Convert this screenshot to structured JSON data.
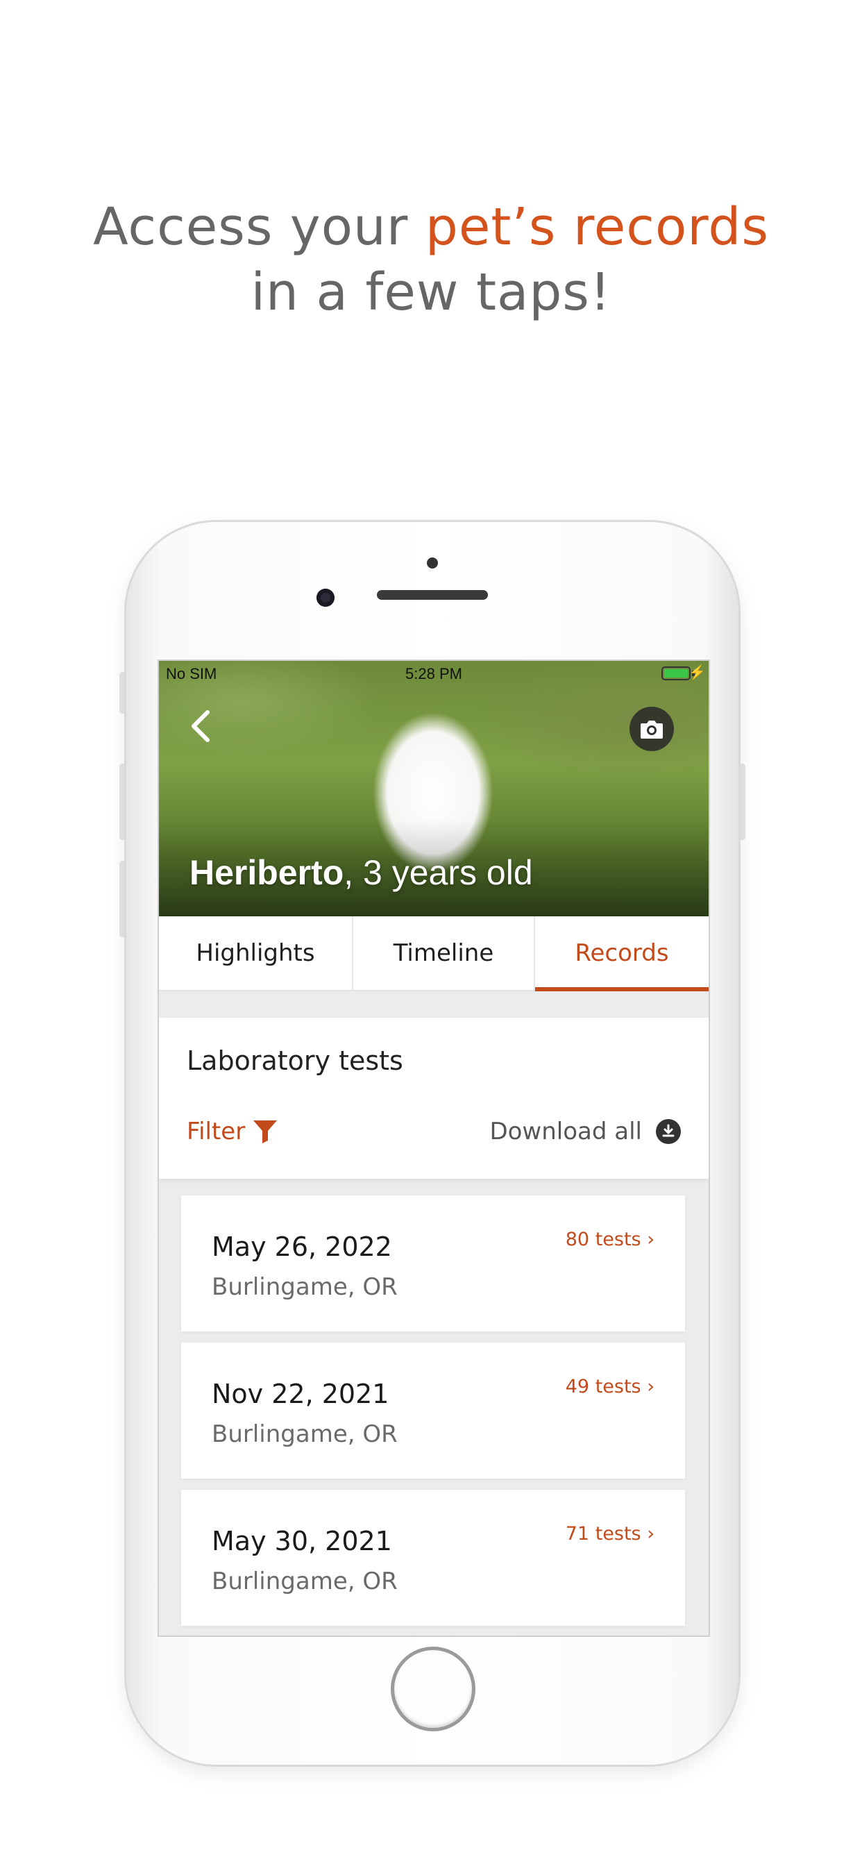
{
  "headline": {
    "line1_plain": "Access your ",
    "line1_accent": "pet’s records",
    "line2": "in a few taps!"
  },
  "status_bar": {
    "carrier": "No SIM",
    "time": "5:28 PM",
    "battery_level": 1.0,
    "charging_icon": "bolt-icon"
  },
  "pet": {
    "name": "Heriberto",
    "age_text": ", 3 years old"
  },
  "icons": {
    "back": "chevron-left-icon",
    "camera": "camera-icon",
    "filter": "funnel-icon",
    "download": "download-icon"
  },
  "tabs": [
    {
      "label": "Highlights",
      "active": false
    },
    {
      "label": "Timeline",
      "active": false
    },
    {
      "label": "Records",
      "active": true
    }
  ],
  "lab_section": {
    "title": "Laboratory tests",
    "filter_label": "Filter",
    "download_label": "Download all"
  },
  "records": [
    {
      "date": "May 26, 2022",
      "location": "Burlingame, OR",
      "count": "80 tests ›"
    },
    {
      "date": "Nov 22, 2021",
      "location": "Burlingame, OR",
      "count": "49 tests ›"
    },
    {
      "date": "May 30, 2021",
      "location": "Burlingame, OR",
      "count": "71 tests ›"
    }
  ],
  "colors": {
    "accent": "#c24a1b",
    "headline_accent": "#d4521c",
    "headline_text": "#666666"
  }
}
